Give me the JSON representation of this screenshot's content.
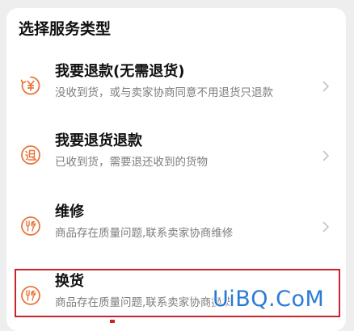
{
  "page": {
    "title": "选择服务类型"
  },
  "options": [
    {
      "label": "我要退款(无需退货)",
      "description": "没收到货，或与卖家协商同意不用退货只退款",
      "icon": "yen-refund-icon"
    },
    {
      "label": "我要退货退款",
      "description": "已收到货，需要退还收到的货物",
      "icon": "return-icon"
    },
    {
      "label": "维修",
      "description": "商品存在质量问题,联系卖家协商维修",
      "icon": "repair-icon"
    },
    {
      "label": "换货",
      "description": "商品存在质量问题,联系卖家协商换货",
      "icon": "exchange-icon"
    }
  ],
  "watermark": {
    "text": "UiBQ.CoM"
  },
  "colors": {
    "accent": "#e8763a",
    "highlight_border": "#c9242c",
    "watermark": "#2a7bd6"
  }
}
